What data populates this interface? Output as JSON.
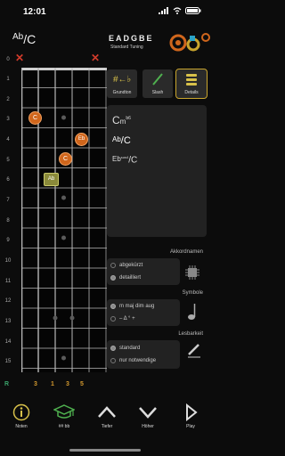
{
  "status": {
    "time": "12:01"
  },
  "header": {
    "chord_root": "Ab",
    "chord_slash": "/C",
    "tuning": "EADGBE",
    "tuning_name": "Standard Tuning"
  },
  "fret_numbers": [
    "0",
    "1",
    "2",
    "3",
    "4",
    "5",
    "6",
    "7",
    "8",
    "9",
    "10",
    "11",
    "12",
    "13",
    "14",
    "15"
  ],
  "open_string_markers": {
    "low_e": "✕",
    "high_e": "✕"
  },
  "notes": {
    "c_fret3": "C",
    "eb_fret4": "Eb",
    "c_fret5": "C",
    "ab_fret6": "Ab"
  },
  "fingering_row": {
    "label": "R",
    "fingers": [
      "3",
      "1",
      "3",
      "5"
    ]
  },
  "toolbar": {
    "grundton": "Grundton",
    "slash": "Slash",
    "details": "Details"
  },
  "chord_names": {
    "name1_root": "C",
    "name1_quality": "m",
    "name1_ext": "b6",
    "name2_root": "Ab",
    "name2_slash": "/C",
    "name3_root": "Eb",
    "name3_ext": "sus4",
    "name3_slash": "/C"
  },
  "akkordnamen": {
    "title": "Akkordnamen",
    "options": [
      "abgekürzt",
      "detailliert"
    ],
    "selected": 1
  },
  "symbole": {
    "title": "Symbole",
    "options": [
      "m maj dim aug",
      "–  Δ  °  +"
    ],
    "selected": 0
  },
  "lesbarkeit": {
    "title": "Lesbarkeit",
    "options": [
      "standard",
      "nur notwendige"
    ],
    "selected": 0
  },
  "bottom": {
    "noten": "Noten",
    "sharp_flat": "## bb",
    "tiefer": "Tiefer",
    "hoeher": "Höher",
    "play": "Play"
  },
  "colors": {
    "accent_orange": "#d0661c",
    "accent_yellow": "#c9a52e",
    "ab_green": "#8a8a3a",
    "mute_red": "#d23b2b"
  }
}
